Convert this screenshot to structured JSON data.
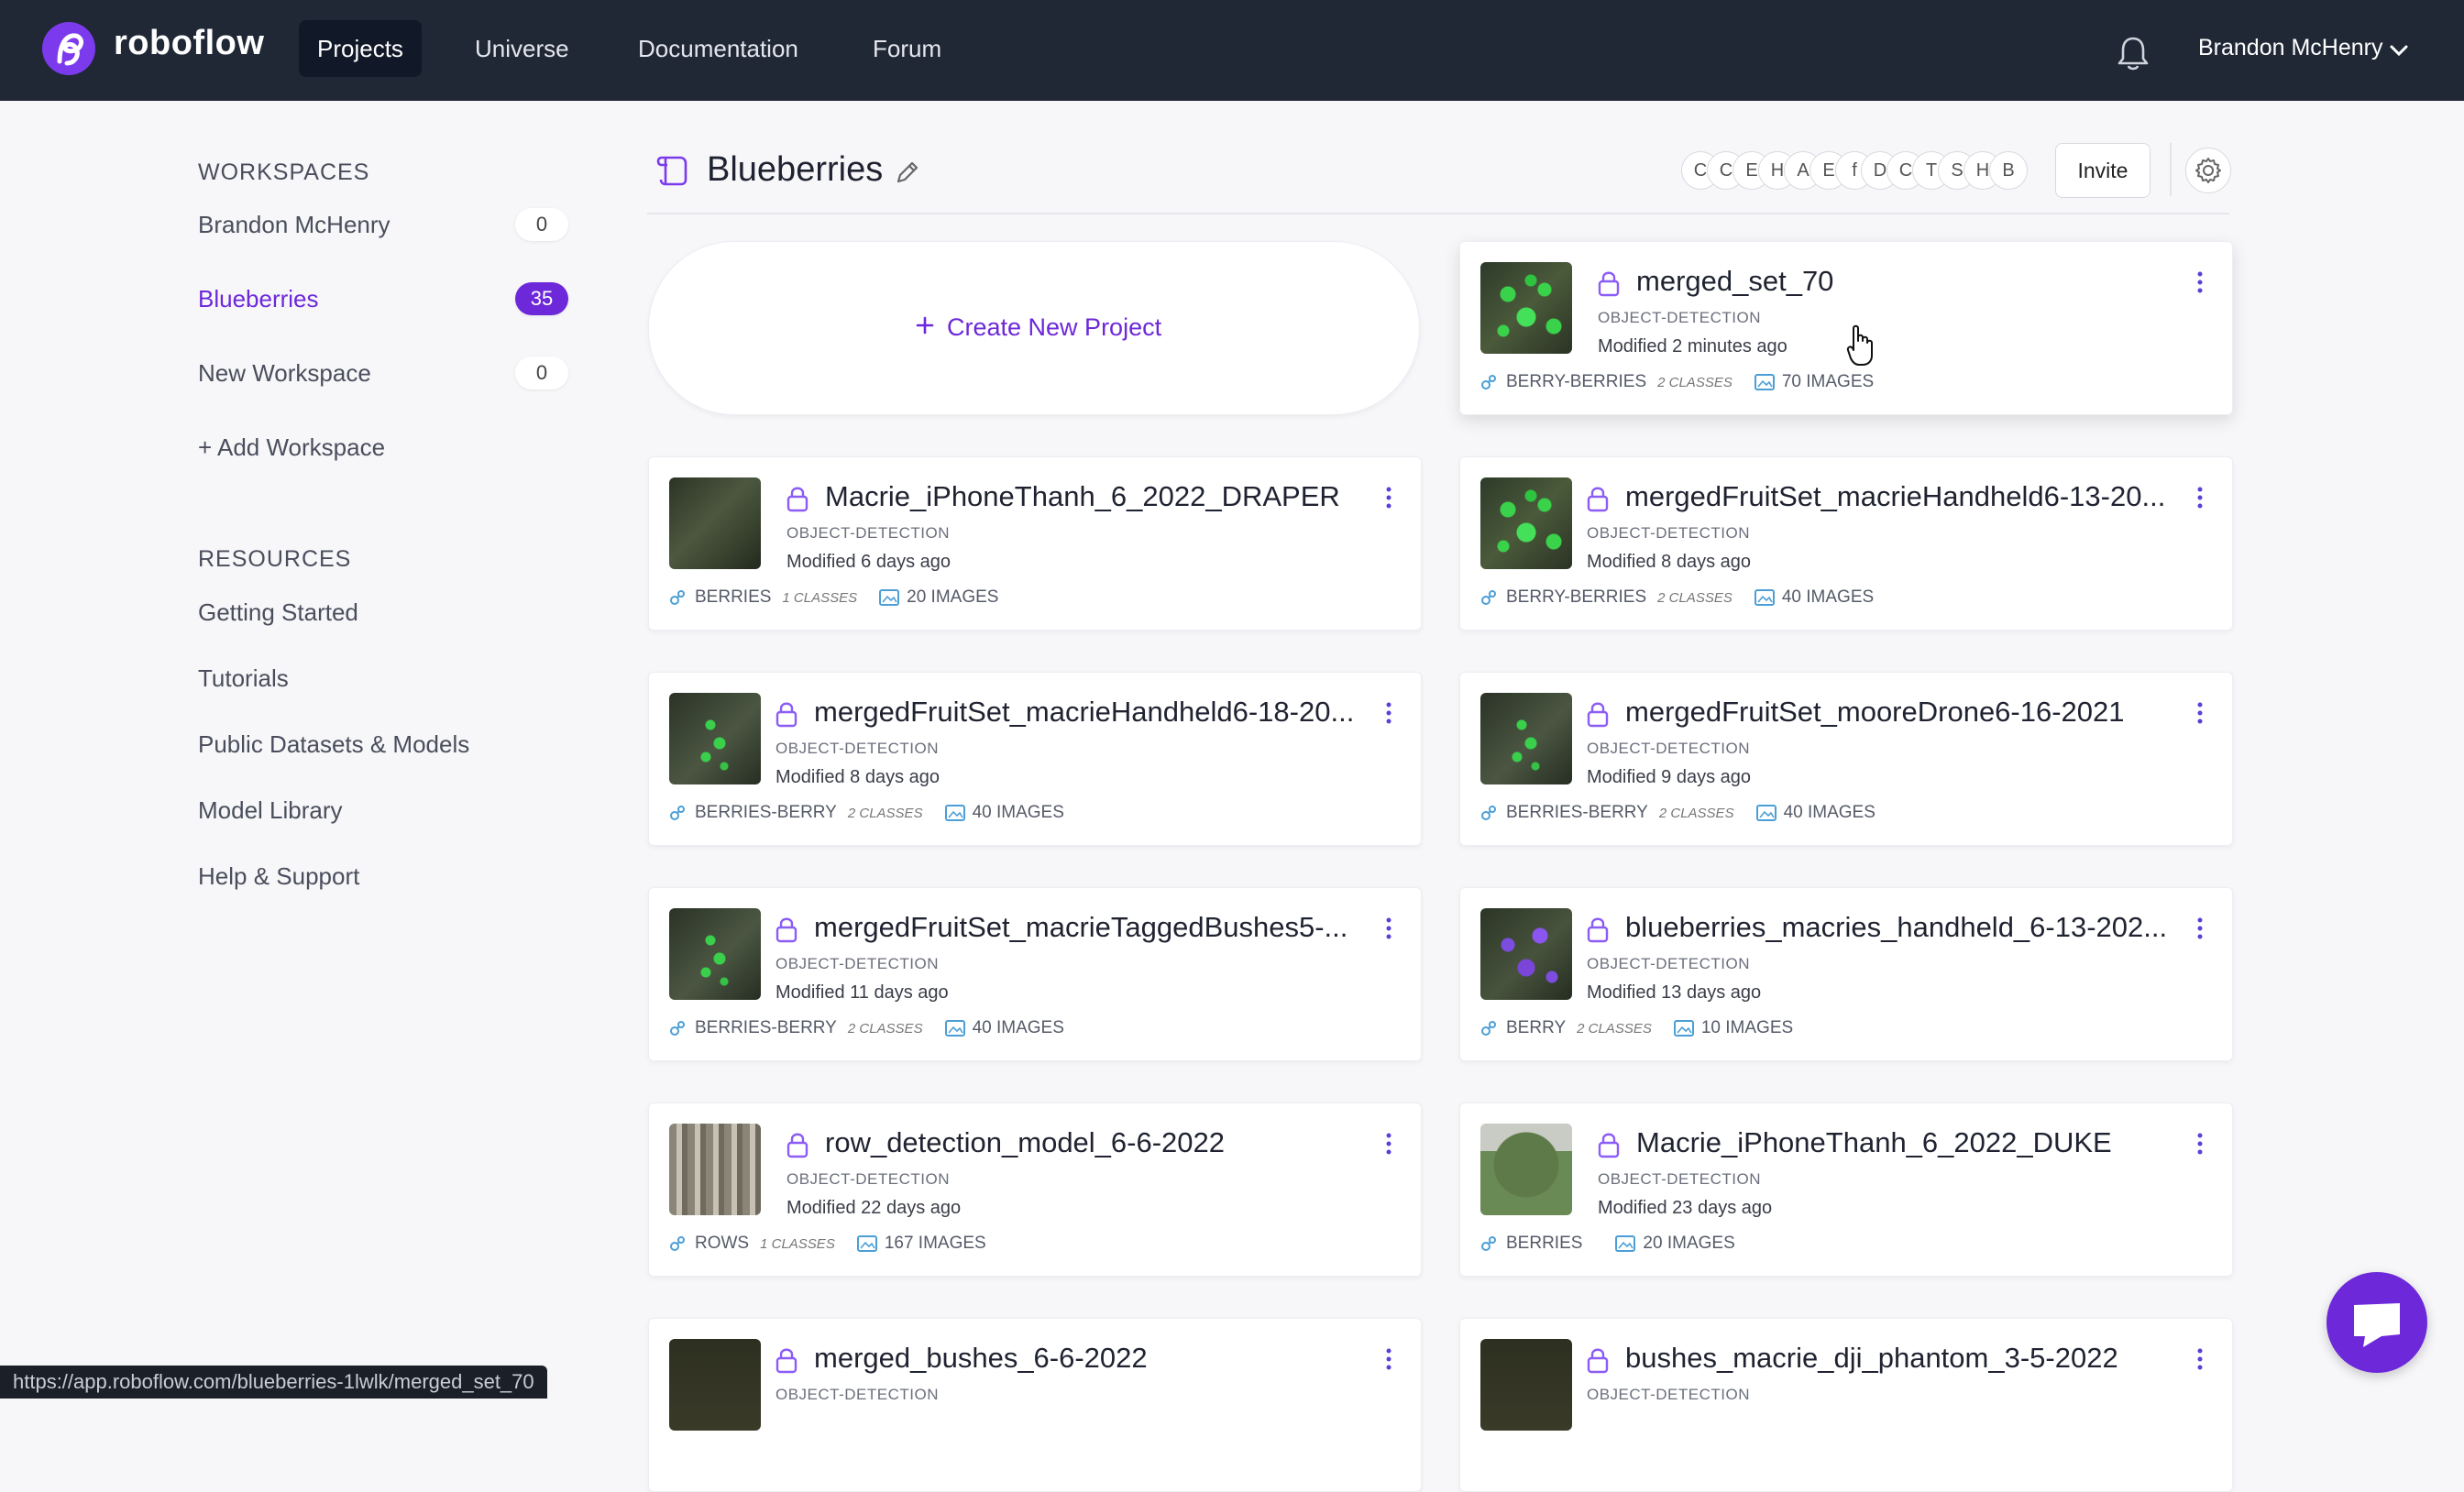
{
  "nav": {
    "logo_text": "roboflow",
    "items": [
      "Projects",
      "Universe",
      "Documentation",
      "Forum"
    ],
    "user_name": "Brandon McHenry"
  },
  "sidebar": {
    "workspaces_heading": "WORKSPACES",
    "workspaces": [
      {
        "label": "Brandon McHenry",
        "count": "0"
      },
      {
        "label": "Blueberries",
        "count": "35"
      },
      {
        "label": "New Workspace",
        "count": "0"
      }
    ],
    "add_workspace": "+ Add Workspace",
    "resources_heading": "RESOURCES",
    "resources": [
      "Getting Started",
      "Tutorials",
      "Public Datasets & Models",
      "Model Library",
      "Help & Support"
    ]
  },
  "header": {
    "title": "Blueberries",
    "members": [
      "C",
      "C",
      "E",
      "H",
      "A",
      "E",
      "f",
      "D",
      "C",
      "T",
      "S",
      "H",
      "B"
    ],
    "invite_label": "Invite"
  },
  "create_label": "Create New Project",
  "projects": [
    {
      "name": "merged_set_70",
      "type": "OBJECT-DETECTION",
      "modified": "Modified 2 minutes ago",
      "classes_name": "BERRY-BERRIES",
      "classes": "2 CLASSES",
      "images": "70 IMAGES",
      "thumb": "green"
    },
    {
      "name": "Macrie_iPhoneThanh_6_2022_DRAPER",
      "type": "OBJECT-DETECTION",
      "modified": "Modified 6 days ago",
      "classes_name": "BERRIES",
      "classes": "1 CLASSES",
      "images": "20 IMAGES",
      "thumb": "dark"
    },
    {
      "name": "mergedFruitSet_macrieHandheld6-13-20...",
      "type": "OBJECT-DETECTION",
      "modified": "Modified 8 days ago",
      "classes_name": "BERRY-BERRIES",
      "classes": "2 CLASSES",
      "images": "40 IMAGES",
      "thumb": "green"
    },
    {
      "name": "mergedFruitSet_macrieHandheld6-18-20...",
      "type": "OBJECT-DETECTION",
      "modified": "Modified 8 days ago",
      "classes_name": "BERRIES-BERRY",
      "classes": "2 CLASSES",
      "images": "40 IMAGES",
      "thumb": "green-sparse"
    },
    {
      "name": "mergedFruitSet_mooreDrone6-16-2021",
      "type": "OBJECT-DETECTION",
      "modified": "Modified 9 days ago",
      "classes_name": "BERRIES-BERRY",
      "classes": "2 CLASSES",
      "images": "40 IMAGES",
      "thumb": "green-sparse"
    },
    {
      "name": "mergedFruitSet_macrieTaggedBushes5-...",
      "type": "OBJECT-DETECTION",
      "modified": "Modified 11 days ago",
      "classes_name": "BERRIES-BERRY",
      "classes": "2 CLASSES",
      "images": "40 IMAGES",
      "thumb": "green-sparse"
    },
    {
      "name": "blueberries_macries_handheld_6-13-202...",
      "type": "OBJECT-DETECTION",
      "modified": "Modified 13 days ago",
      "classes_name": "BERRY",
      "classes": "2 CLASSES",
      "images": "10 IMAGES",
      "thumb": "purple"
    },
    {
      "name": "row_detection_model_6-6-2022",
      "type": "OBJECT-DETECTION",
      "modified": "Modified 22 days ago",
      "classes_name": "ROWS",
      "classes": "1 CLASSES",
      "images": "167 IMAGES",
      "thumb": "trees"
    },
    {
      "name": "Macrie_iPhoneThanh_6_2022_DUKE",
      "type": "OBJECT-DETECTION",
      "modified": "Modified 23 days ago",
      "classes_name": "BERRIES",
      "classes": "",
      "images": "20 IMAGES",
      "thumb": "bush"
    },
    {
      "name": "merged_bushes_6-6-2022",
      "type": "OBJECT-DETECTION",
      "modified": "",
      "classes_name": "",
      "classes": "",
      "images": "",
      "thumb": "yellow"
    },
    {
      "name": "bushes_macrie_dji_phantom_3-5-2022",
      "type": "OBJECT-DETECTION",
      "modified": "",
      "classes_name": "",
      "classes": "",
      "images": "",
      "thumb": "yellow"
    }
  ],
  "status_url": "https://app.roboflow.com/blueberries-1lwlk/merged_set_70",
  "colors": {
    "accent": "#6d28d9",
    "nav_bg": "#202836"
  }
}
